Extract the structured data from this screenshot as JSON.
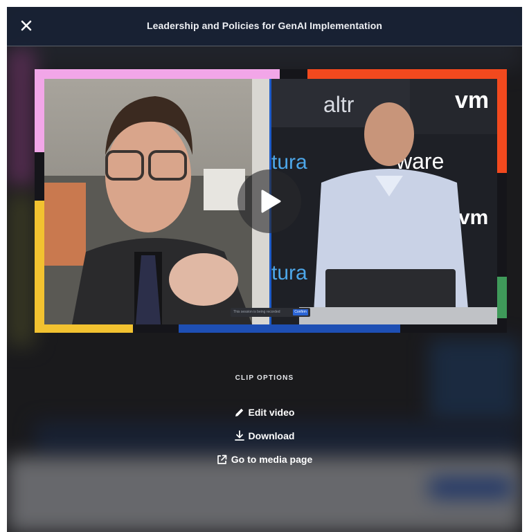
{
  "modal": {
    "title": "Leadership and Policies for GenAI Implementation"
  },
  "video": {
    "overlay_logos": [
      "vm",
      "ware",
      "tura",
      "altr"
    ],
    "recording_notice": "This session is being recorded",
    "recording_confirm": "Confirm",
    "accent_colors": {
      "pink": "#f2a6e8",
      "orange": "#f2491e",
      "yellow": "#f2c230",
      "blue": "#1e4fb4",
      "green": "#3f9a5a"
    }
  },
  "clip_options": {
    "heading": "CLIP OPTIONS",
    "items": [
      {
        "label": "Edit video",
        "icon": "pencil-icon"
      },
      {
        "label": "Download",
        "icon": "download-icon"
      },
      {
        "label": "Go to media page",
        "icon": "external-link-icon"
      }
    ]
  }
}
